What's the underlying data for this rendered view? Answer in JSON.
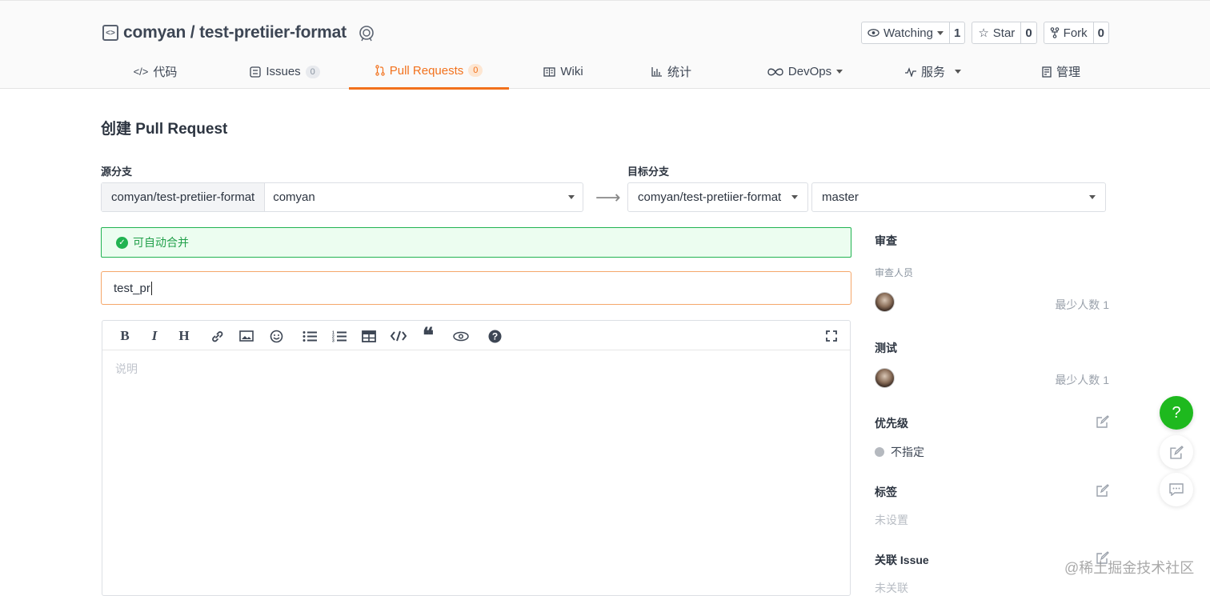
{
  "repo": {
    "full_name": "comyan / test-pretiier-format"
  },
  "actions": {
    "watching": {
      "label": "Watching",
      "count": "1"
    },
    "star": {
      "label": "Star",
      "count": "0"
    },
    "fork": {
      "label": "Fork",
      "count": "0"
    }
  },
  "tabs": [
    {
      "label": "代码",
      "icon": "code-icon"
    },
    {
      "label": "Issues",
      "count": "0",
      "icon": "issues-icon"
    },
    {
      "label": "Pull Requests",
      "count": "0",
      "icon": "pull-request-icon",
      "active": true
    },
    {
      "label": "Wiki",
      "icon": "wiki-icon"
    },
    {
      "label": "统计",
      "icon": "chart-icon"
    },
    {
      "label": "DevOps",
      "icon": "infinity-icon"
    },
    {
      "label": "服务",
      "icon": "pulse-icon"
    },
    {
      "label": "管理",
      "icon": "manage-icon"
    }
  ],
  "page": {
    "title": "创建 Pull Request"
  },
  "source": {
    "label": "源分支",
    "repo": "comyan/test-pretiier-format",
    "branch": "comyan"
  },
  "target": {
    "label": "目标分支",
    "repo": "comyan/test-pretiier-format",
    "branch": "master"
  },
  "merge_status": "可自动合并",
  "pr_title_value": "test_pr",
  "editor": {
    "placeholder": "说明"
  },
  "sidebar": {
    "review": {
      "title": "审查",
      "reviewers_label": "审查人员",
      "min_count": "最少人数 1"
    },
    "test": {
      "title": "测试",
      "min_count": "最少人数 1"
    },
    "priority": {
      "title": "优先级",
      "value": "不指定"
    },
    "labels": {
      "title": "标签",
      "value": "未设置"
    },
    "issue": {
      "title": "关联 Issue",
      "value": "未关联"
    }
  },
  "watermark": "@稀土掘金技术社区",
  "colors": {
    "accent": "#f2711c",
    "success": "#21b351",
    "help": "#1eb91e"
  }
}
